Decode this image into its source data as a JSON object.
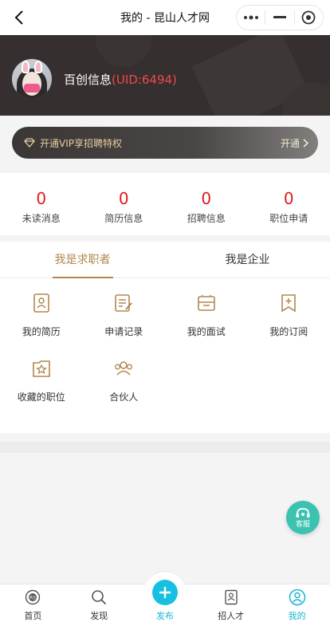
{
  "topbar": {
    "title": "我的 - 昆山人才网"
  },
  "profile": {
    "name": "百创信息",
    "uid": "(UID:6494)"
  },
  "vip": {
    "text": "开通VIP享招聘特权",
    "action": "开通"
  },
  "stats": [
    {
      "value": "0",
      "label": "未读消息"
    },
    {
      "value": "0",
      "label": "简历信息"
    },
    {
      "value": "0",
      "label": "招聘信息"
    },
    {
      "value": "0",
      "label": "职位申请"
    }
  ],
  "role_tabs": [
    {
      "label": "我是求职者"
    },
    {
      "label": "我是企业"
    }
  ],
  "menu": [
    {
      "label": "我的简历",
      "icon": "resume-icon"
    },
    {
      "label": "申请记录",
      "icon": "application-record-icon"
    },
    {
      "label": "我的面试",
      "icon": "interview-icon"
    },
    {
      "label": "我的订阅",
      "icon": "subscription-icon"
    },
    {
      "label": "收藏的职位",
      "icon": "favorite-job-icon"
    },
    {
      "label": "合伙人",
      "icon": "partner-icon"
    }
  ],
  "service": {
    "label": "客服"
  },
  "bottom_nav": [
    {
      "label": "首页",
      "icon": "home-icon"
    },
    {
      "label": "发现",
      "icon": "discover-icon"
    },
    {
      "label": "发布",
      "icon": "publish-icon"
    },
    {
      "label": "招人才",
      "icon": "recruit-icon"
    },
    {
      "label": "我的",
      "icon": "mine-icon"
    }
  ],
  "colors": {
    "accent_gold": "#b0884d",
    "stat_red": "#e01a1a",
    "nav_active": "#16b6d4",
    "service_green": "#3cc2b0"
  }
}
